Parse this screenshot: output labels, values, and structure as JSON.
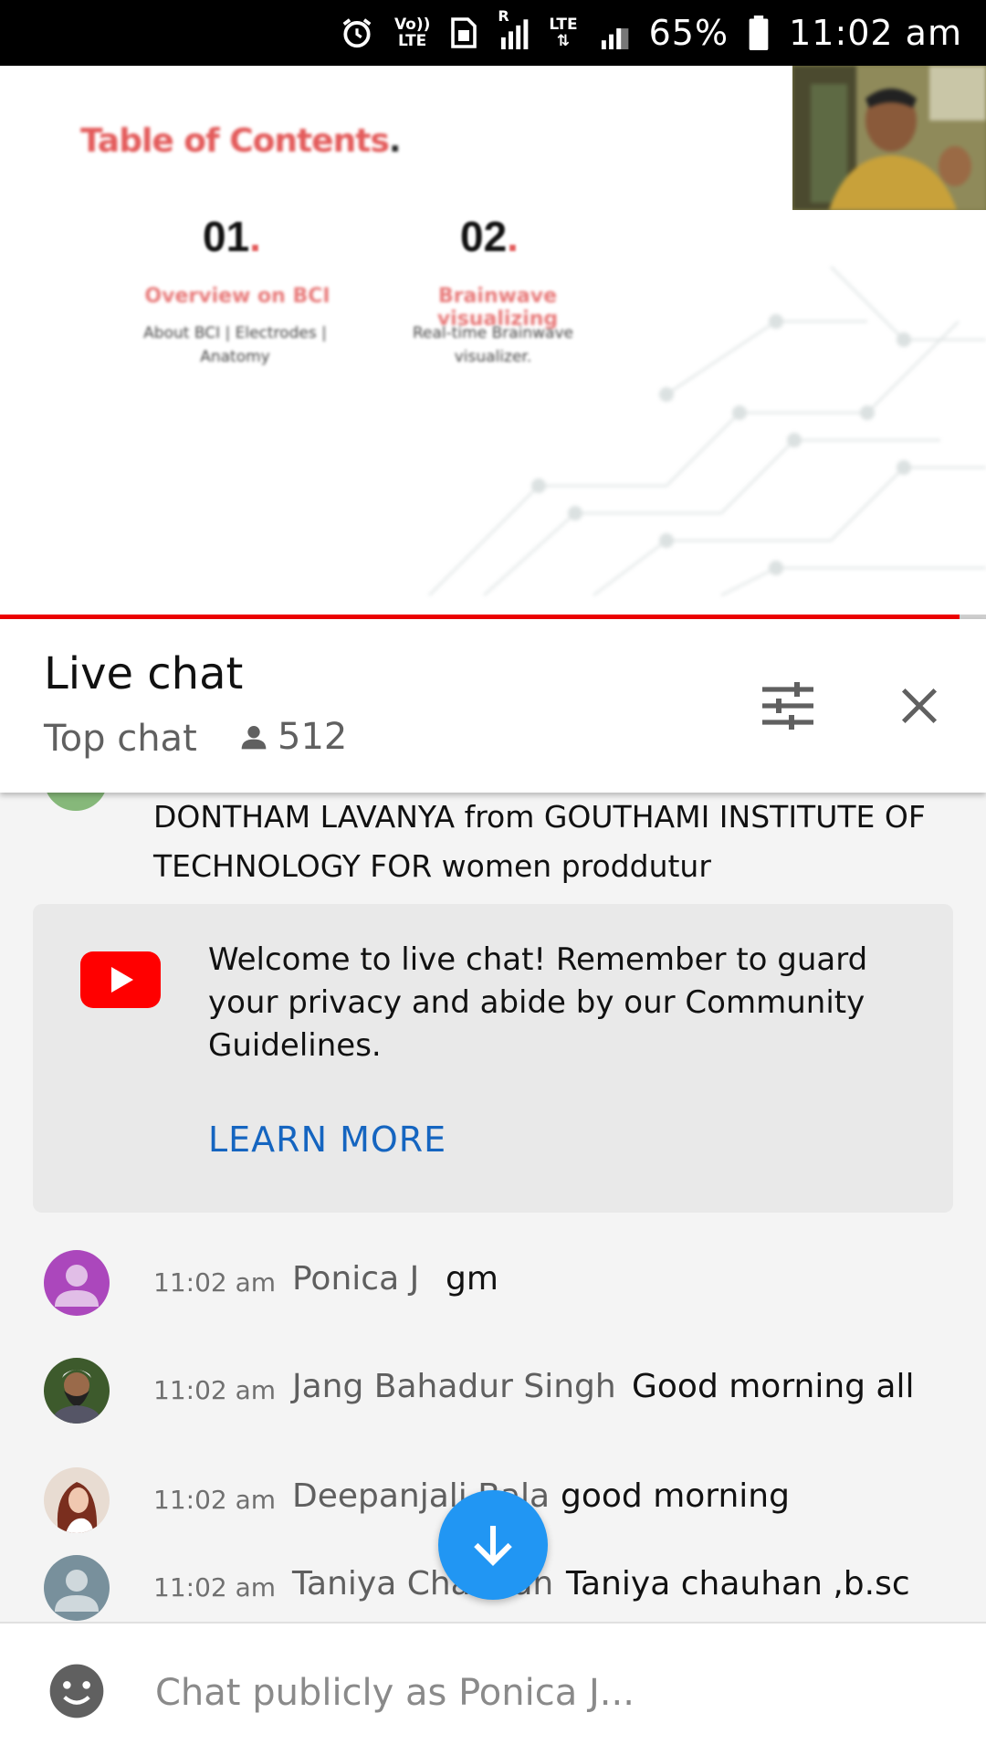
{
  "status_bar": {
    "volte_top": "Vo))",
    "volte_bottom": "LTE",
    "network_r": "R",
    "network_lte": "LTE",
    "battery": "65%",
    "time": "11:02 am"
  },
  "video": {
    "slide_title": "Table of Contents",
    "slide_title_dot": ".",
    "sections": [
      {
        "number": "01",
        "heading": "Overview on BCI",
        "sub": "About BCI | Electrodes | Anatomy"
      },
      {
        "number": "02",
        "heading": "Brainwave visualizing",
        "sub": "Real-time Brainwave visualizer."
      }
    ],
    "progress_fraction": 0.973
  },
  "chat_header": {
    "title": "Live chat",
    "mode": "Top chat",
    "viewer_count": "512"
  },
  "chat": {
    "partial_message": "DONTHAM LAVANYA from GOUTHAMI INSTITUTE OF TECHNOLOGY FOR women proddutur",
    "welcome": {
      "text": "Welcome to live chat! Remember to guard your privacy and abide by our Community Guidelines.",
      "link": "LEARN MORE"
    },
    "messages": [
      {
        "time": "11:02 am",
        "author": "Ponica J",
        "text": "gm",
        "avatar_color": "#ab47bc"
      },
      {
        "time": "11:02 am",
        "author": "Jang Bahadur Singh",
        "text": "Good morning all",
        "avatar_color": "#4e6b3a"
      },
      {
        "time": "11:02 am",
        "author": "Deepanjali Bala",
        "text": "good morning",
        "avatar_color": "#7a3b2e"
      },
      {
        "time": "11:02 am",
        "author": "Taniya Chauhan",
        "text": "Taniya chauhan ,b.sc",
        "avatar_color": "#78909c"
      }
    ]
  },
  "input": {
    "placeholder": "Chat publicly as Ponica J..."
  },
  "colors": {
    "accent_blue": "#2196f3",
    "link_blue": "#1565c0",
    "youtube_red": "#ff0000",
    "progress_red": "#e00000"
  }
}
